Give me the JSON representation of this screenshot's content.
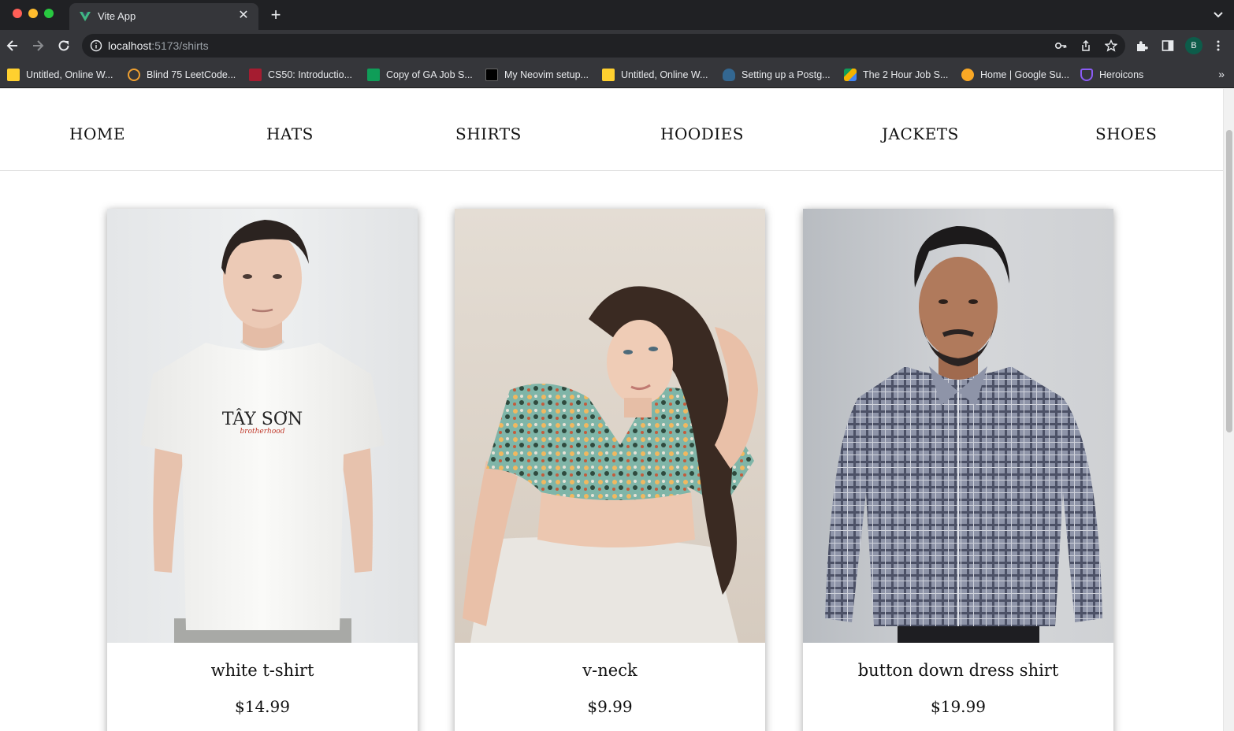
{
  "browser": {
    "tab_title": "Vite App",
    "url_host": "localhost",
    "url_rest": ":5173/shirts",
    "profile_initial": "B",
    "bookmarks": [
      {
        "label": "Untitled, Online W...",
        "icon": "miro-icon",
        "color": "#ffd02f"
      },
      {
        "label": "Blind 75 LeetCode...",
        "icon": "leetcode-icon",
        "color": "#f0a030"
      },
      {
        "label": "CS50: Introductio...",
        "icon": "harvard-icon",
        "color": "#a51c30"
      },
      {
        "label": "Copy of GA Job S...",
        "icon": "sheets-icon",
        "color": "#0f9d58"
      },
      {
        "label": "My Neovim setup...",
        "icon": "dev-icon",
        "color": "#000000"
      },
      {
        "label": "Untitled, Online W...",
        "icon": "miro-icon",
        "color": "#ffd02f"
      },
      {
        "label": "Setting up a Postg...",
        "icon": "postgres-icon",
        "color": "#336791"
      },
      {
        "label": "The 2 Hour Job S...",
        "icon": "drive-icon",
        "color": "#4285f4"
      },
      {
        "label": "Home | Google Su...",
        "icon": "google-support-icon",
        "color": "#f9a825"
      },
      {
        "label": "Heroicons",
        "icon": "heroicons-icon",
        "color": "#8b5cf6"
      }
    ]
  },
  "nav": {
    "links": [
      "HOME",
      "HATS",
      "SHIRTS",
      "HOODIES",
      "JACKETS",
      "SHOES"
    ]
  },
  "products": [
    {
      "name": "white t-shirt",
      "price": "$14.99",
      "image": "man-white-tshirt-photo"
    },
    {
      "name": "v-neck",
      "price": "$9.99",
      "image": "woman-floral-top-photo"
    },
    {
      "name": "button down dress shirt",
      "price": "$19.99",
      "image": "man-plaid-shirt-photo"
    }
  ],
  "tshirt_print": {
    "brand": "TÂY SƠN",
    "tagline": "brotherhood"
  },
  "colors": {
    "chrome_dark": "#202124",
    "chrome_mid": "#35363a",
    "text_light": "#e8eaed"
  }
}
